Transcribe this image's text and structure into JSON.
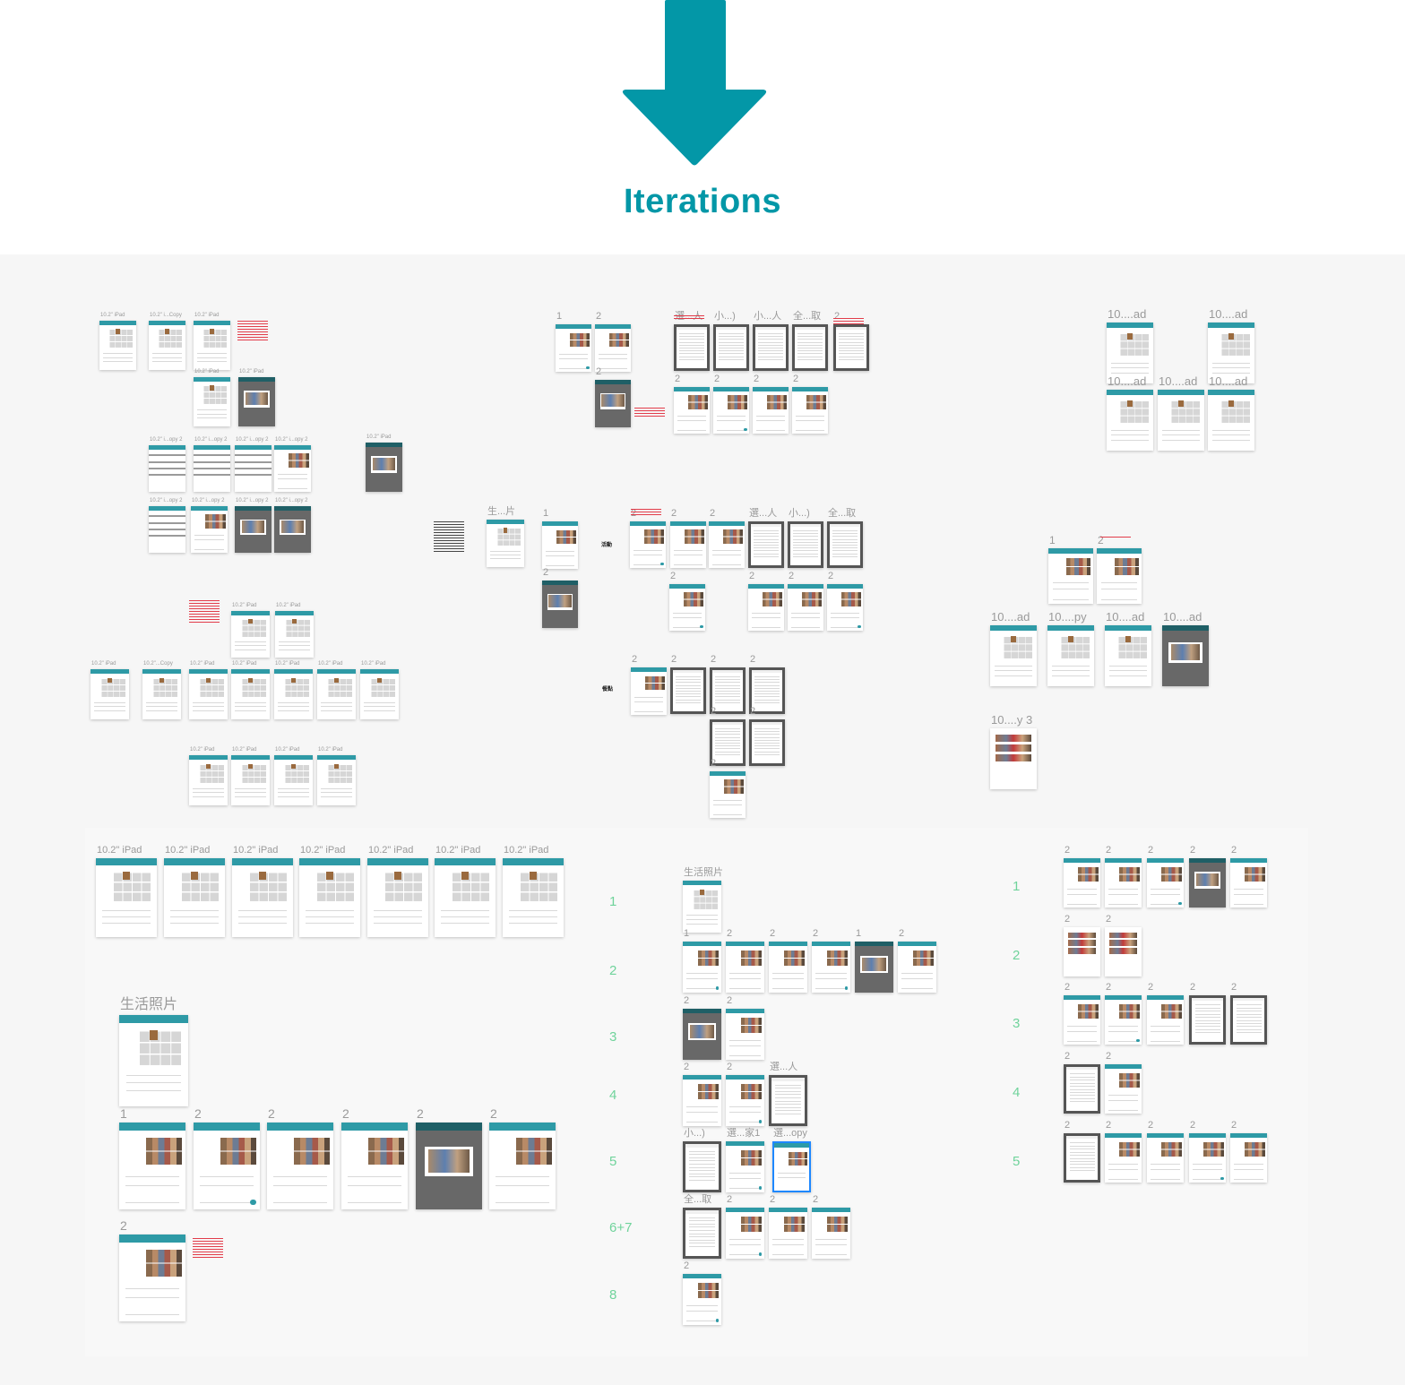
{
  "header": {
    "title": "Iterations",
    "arrow_icon": "arrow-down-icon",
    "accent_color": "#0397a7"
  },
  "section_labels": [
    "活動",
    "餐點"
  ],
  "row_labels_middle": [
    "1",
    "2",
    "3",
    "4",
    "5",
    "6+7",
    "8"
  ],
  "row_labels_right": [
    "1",
    "2",
    "3",
    "4",
    "5"
  ],
  "frames": [
    "10.2\" iPad",
    "10.2\" i...Copy",
    "10.2\" iPad",
    "10.2\" iPad",
    "10.2\" iPad",
    "10.2\" i...opy 2",
    "10.2\" i...opy 2",
    "10.2\" i...opy 2",
    "10.2\" i...opy 2",
    "10.2\" iPad",
    "10.2\" i...opy 2",
    "10.2\" i...opy 2",
    "10.2\" i...opy 2",
    "10.2\" i...opy 2",
    "10.2\" iPad",
    "10.2\" iPad",
    "10.2\" iPad",
    "10.2\"...Copy",
    "10.2\" iPad",
    "10.2\" iPad",
    "10.2\" iPad",
    "10.2\" iPad",
    "10.2\" iPad",
    "10.2\" iPad",
    "10.2\" iPad",
    "10.2\" iPad",
    "10.2\" iPad",
    "10.2\" iPad",
    "10.2\" iPad",
    "10.2\" iPad",
    "10.2\" iPad",
    "10.2\" iPad",
    "10.2\" iPad",
    "10.2\" iPad",
    "生活照片",
    "1",
    "2",
    "2",
    "2",
    "2",
    "2",
    "2",
    "1",
    "2",
    "2",
    "選...人",
    "小...)",
    "小...人",
    "全...取",
    "2",
    "2",
    "2",
    "2",
    "2",
    "生...片",
    "1",
    "2",
    "2",
    "2",
    "2",
    "選...人",
    "小...)",
    "全...取",
    "2",
    "2",
    "2",
    "2",
    "2",
    "2",
    "2",
    "2",
    "2",
    "2",
    "2",
    "10....ad",
    "10....ad",
    "10....ad",
    "10....ad",
    "10....ad",
    "1",
    "2",
    "10....ad",
    "10....py",
    "10....ad",
    "10....ad",
    "10....y 3",
    "生活照片",
    "1",
    "2",
    "2",
    "2",
    "1",
    "2",
    "2",
    "2",
    "2",
    "2",
    "選...人",
    "小...)",
    "選...家1",
    "選...opy",
    "全...取",
    "2",
    "2",
    "2",
    "2",
    "2",
    "2",
    "2",
    "2",
    "2",
    "2",
    "2",
    "2",
    "2",
    "2",
    "2",
    "2",
    "2",
    "2",
    "2",
    "2",
    "2",
    "2",
    "2"
  ]
}
